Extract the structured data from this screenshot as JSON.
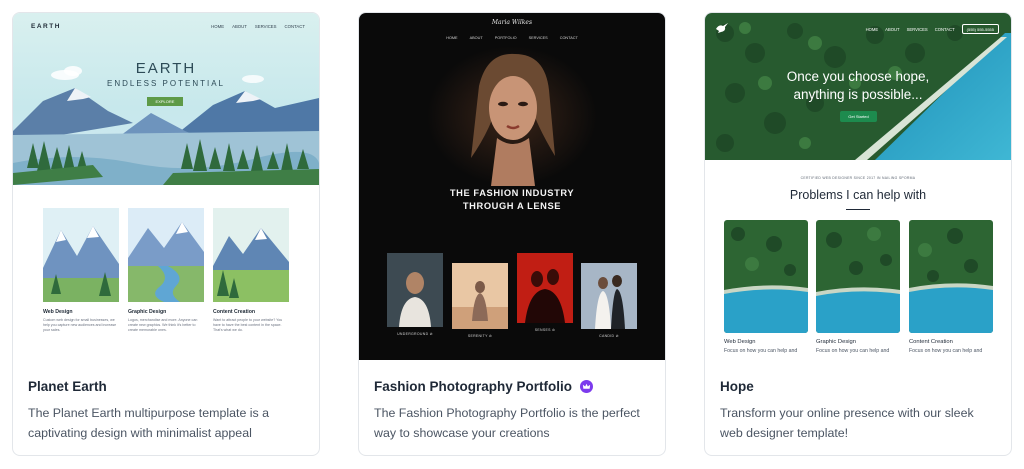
{
  "cards": [
    {
      "title": "Planet Earth",
      "description": "The Planet Earth multipurpose template is a captivating design with minimalist appeal",
      "preview": {
        "logo": "EARTH",
        "nav": [
          "HOME",
          "ABOUT",
          "SERVICES",
          "CONTACT"
        ],
        "headline": "EARTH",
        "subheadline": "ENDLESS POTENTIAL",
        "button": "EXPLORE",
        "services": [
          {
            "title": "Web Design",
            "text": "Custom web design for small businesses, we help you capture new audiences and increase your sales."
          },
          {
            "title": "Graphic Design",
            "text": "Logos, merchandise and more. Anyone can create new graphics. We think it's better to create memorable ones."
          },
          {
            "title": "Content Creation",
            "text": "Want to attract people to your website? You have to have the best content in the space. That's what we do."
          }
        ]
      }
    },
    {
      "title": "Fashion Photography Portfolio",
      "premium_icon": "crown-icon",
      "description": "The Fashion Photography Portfolio is the perfect way to showcase your creations",
      "preview": {
        "brand": "Maria Wilkes",
        "nav": [
          "HOME",
          "ABOUT",
          "PORTFOLIO",
          "SERVICES",
          "CONTACT"
        ],
        "headline_line1": "THE FASHION INDUSTRY",
        "headline_line2": "THROUGH A LENSE",
        "tiles": [
          "UNDERGROUND ⊘",
          "SERENITY ⊘",
          "SENSES ⊘",
          "CANDID ⊘"
        ]
      }
    },
    {
      "title": "Hope",
      "description": "Transform your online presence with our sleek web designer template!",
      "preview": {
        "logo_icon": "dove-icon",
        "nav": [
          "HOME",
          "ABOUT",
          "SERVICES",
          "CONTACT"
        ],
        "phone": "(555) 555-5555",
        "headline_line1": "Once you choose hope,",
        "headline_line2": "anything is possible...",
        "button": "Get Started",
        "eyebrow": "CERTIFIED WEB DESIGNER SINCE 2017 IN NAILING SPORMA",
        "section_title": "Problems I can help with",
        "services": [
          {
            "title": "Web Design",
            "text": "Focus on how you can help and"
          },
          {
            "title": "Graphic Design",
            "text": "Focus on how you can help and"
          },
          {
            "title": "Content Creation",
            "text": "Focus on how you can help and"
          }
        ]
      }
    }
  ],
  "colors": {
    "premium": "#7c3aed",
    "earth_button": "#5e9a47",
    "hope_button": "#1d8b4e",
    "fashion_bg": "#0a0a0a"
  }
}
